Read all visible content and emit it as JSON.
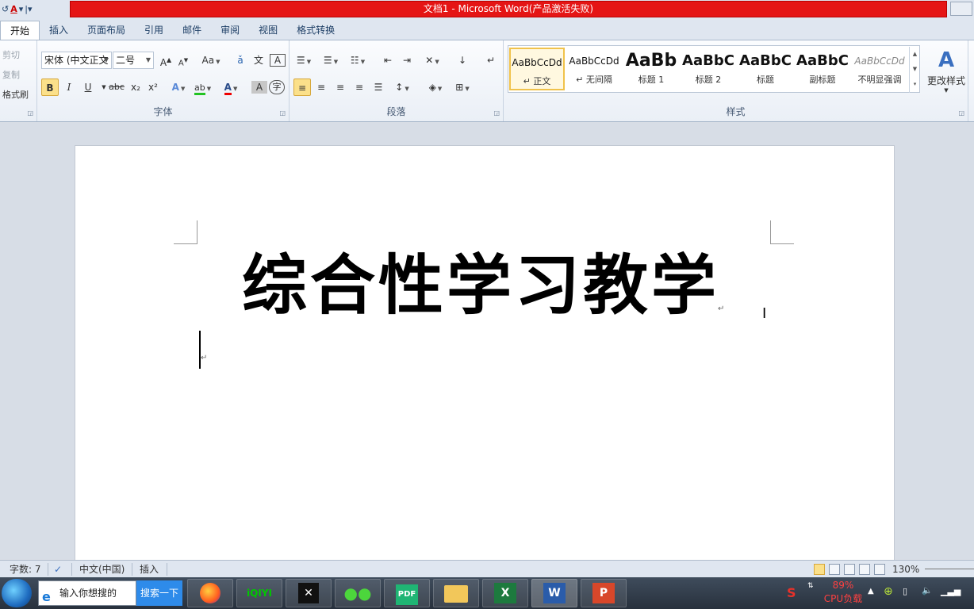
{
  "window": {
    "title": "文档1  -  Microsoft Word(产品激活失败)"
  },
  "ribbon_tabs": [
    "开始",
    "插入",
    "页面布局",
    "引用",
    "邮件",
    "审阅",
    "视图",
    "格式转换"
  ],
  "clipboard": {
    "cut": "剪切",
    "copy": "复制",
    "format_painter": "格式刷"
  },
  "font_group": {
    "font_name": "宋体 (中文正文",
    "font_size": "二号",
    "label": "字体",
    "grow": "A",
    "shrink": "A",
    "case": "Aa",
    "bold": "B",
    "italic": "I",
    "underline": "U",
    "strike": "abc",
    "subscript": "x₂",
    "superscript": "x²"
  },
  "paragraph_group": {
    "label": "段落"
  },
  "styles_group": {
    "label": "样式",
    "items": [
      {
        "sample": "AaBbCcDd",
        "name": "↵ 正文"
      },
      {
        "sample": "AaBbCcDd",
        "name": "↵ 无间隔"
      },
      {
        "sample": "AaBb",
        "name": "标题 1"
      },
      {
        "sample": "AaBbC",
        "name": "标题 2"
      },
      {
        "sample": "AaBbC",
        "name": "标题"
      },
      {
        "sample": "AaBbC",
        "name": "副标题"
      },
      {
        "sample": "AaBbCcDd",
        "name": "不明显强调"
      }
    ],
    "change_styles": "更改样式"
  },
  "document": {
    "title_text": "综合性学习教学",
    "para_mark": "↵"
  },
  "status_bar": {
    "word_count": "字数: 7",
    "language": "中文(中国)",
    "mode": "插入",
    "zoom": "130%"
  },
  "taskbar": {
    "search_placeholder": "输入你想搜的",
    "search_button": "搜索一下",
    "cpu_percent": "89%",
    "cpu_label": "CPU负载",
    "apps": [
      "firefox",
      "iqiyi",
      "capcut",
      "wechat",
      "pdf",
      "explorer",
      "excel",
      "word",
      "powerpoint"
    ],
    "app_labels": {
      "iqiyi": "iQIYI",
      "pdf": "PDF"
    }
  },
  "colors": {
    "title_bar": "#e51515",
    "selected_button": "#fbe08a",
    "accent_blue": "#2e8bea"
  }
}
